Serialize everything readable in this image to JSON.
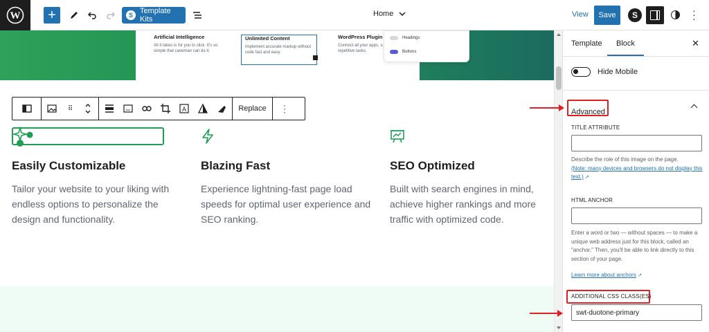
{
  "topbar": {
    "template_kits_label": "Template Kits",
    "template_kits_logo": "S",
    "document_title": "Home",
    "view_label": "View",
    "save_label": "Save",
    "brand_icon_letter": "S"
  },
  "hero": {
    "features": [
      {
        "title": "Artificial Intelligence",
        "text": "All it takes is for you to click. It's so simple that caveman can do it."
      },
      {
        "title": "Unlimited Content",
        "text": "Implement accurate markup without code fast and easy."
      },
      {
        "title": "WordPress Plugin",
        "text": "Connect all your apps, s... repetitive tasks."
      }
    ],
    "panel_items": [
      "Headings",
      "Buttons"
    ]
  },
  "block_toolbar": {
    "replace_label": "Replace"
  },
  "columns": [
    {
      "icon": "sparkle-icon",
      "heading": "Easily Customizable",
      "text": "Tailor your website to your liking with endless options to personalize the design and functionality."
    },
    {
      "icon": "lightning-icon",
      "heading": "Blazing Fast",
      "text": "Experience lightning-fast page load speeds for optimal user experience and SEO ranking."
    },
    {
      "icon": "presentation-chart-icon",
      "heading": "SEO Optimized",
      "text": "Built with search engines in mind, achieve higher rankings and more traffic with optimized code."
    }
  ],
  "sidebar": {
    "tabs": [
      "Template",
      "Block"
    ],
    "active_tab": "Block",
    "hide_mobile_label": "Hide Mobile",
    "advanced_label": "Advanced",
    "title_attribute": {
      "label": "TITLE ATTRIBUTE",
      "value": "",
      "help": "Describe the role of this image on the page.",
      "help_link": "(Note: many devices and browsers do not display this text.)"
    },
    "html_anchor": {
      "label": "HTML ANCHOR",
      "value": "",
      "help": "Enter a word or two — without spaces — to make a unique web address just for this block, called an \"anchor.\" Then, you'll be able to link directly to this section of your page.",
      "help_link": "Learn more about anchors"
    },
    "css_classes": {
      "label": "ADDITIONAL CSS CLASS(ES)",
      "value": "swt-duotone-primary"
    }
  },
  "colors": {
    "accent": "#2271b1",
    "green": "#1f9d55",
    "highlight_red": "#e02020"
  }
}
